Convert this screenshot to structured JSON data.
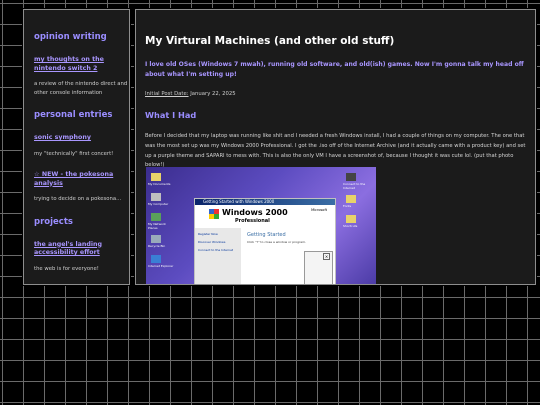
{
  "sidebar": {
    "sections": [
      {
        "title": "opinion writing",
        "items": [
          {
            "label": "my thoughts on the nintendo switch 2",
            "desc": "a review of the nintendo direct and other console information"
          }
        ]
      },
      {
        "title": "personal entries",
        "items": [
          {
            "label": "sonic symphony",
            "desc": "my \"technically\" first concert!"
          },
          {
            "label": "☆ NEW - the pokesona analysis",
            "desc": "trying to decide on a pokesona..."
          }
        ]
      },
      {
        "title": "projects",
        "items": [
          {
            "label": "the angel's landing accessibility effort",
            "desc": "the web is for everyone!"
          }
        ]
      }
    ]
  },
  "post": {
    "title": "My Virtural Machines (and other old stuff)",
    "lead": "I love old OSes (Windows 7 mwah), running old software, and old(ish) games. Now I'm gonna talk my head off about what I'm setting up!",
    "date_label": "Initial Post Date:",
    "date_value": "January 22, 2025",
    "section_heading": "What I Had",
    "paragraph": "Before I decided that my laptop was running like shit and I needed a fresh Windows install, I had a couple of things on my computer. The one that was the most set up was my Windows 2000 Professional. I got the .iso off of the Internet Archive (and it actually came with a product key) and set up a purple theme and SAPARI to mess with. This is also the only VM I have a screenshot of, because I thought it was cute lol. (put that photo below!)"
  },
  "screenshot": {
    "window_title": "Getting Started with Windows 2000",
    "brand": "Windows 2000",
    "edition": "Professional",
    "vendor": "Microsoft",
    "left_links": [
      "Register Now",
      "Discover Windows",
      "Connect to the Internet"
    ],
    "heading": "Getting Started",
    "hint": "Click \"?\" to close a window or program.",
    "desktop_icons": [
      "My Documents",
      "My Computer",
      "My Network Places",
      "Recycle Bin",
      "Internet Explorer",
      "Connect to the Internet",
      "Fonts",
      "Shortcuts"
    ]
  }
}
